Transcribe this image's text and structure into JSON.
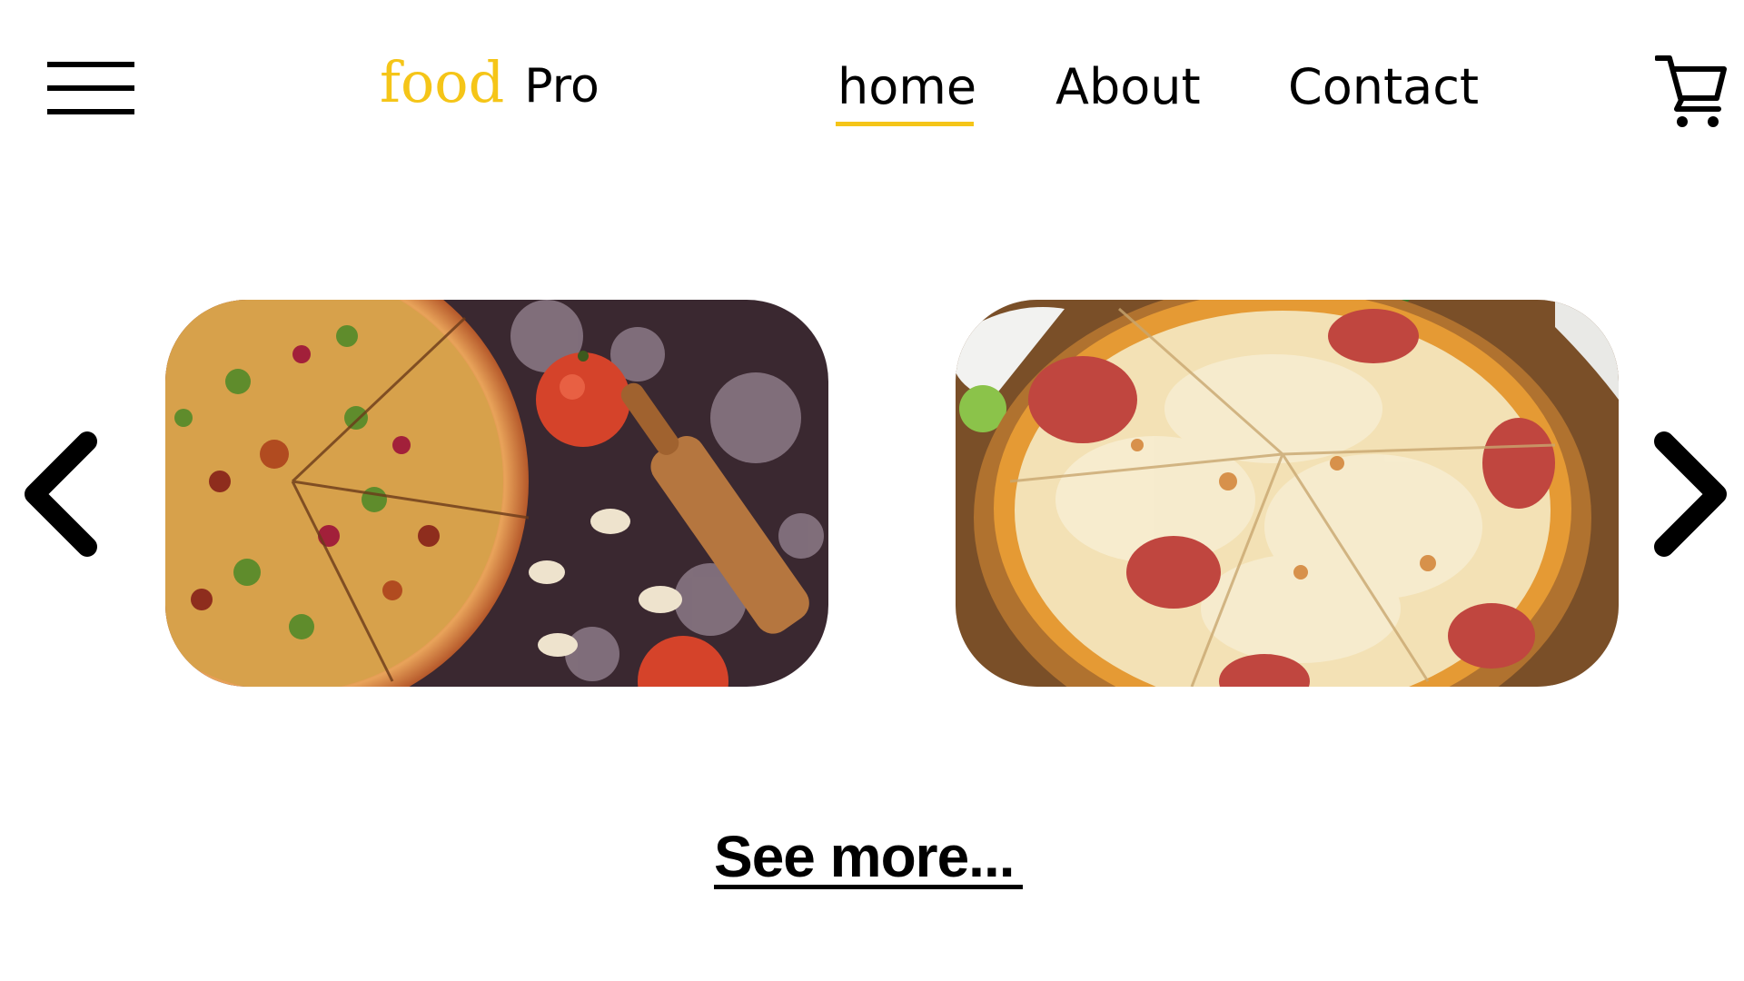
{
  "header": {
    "logo": {
      "primary": "food",
      "secondary": "Pro"
    },
    "nav": [
      {
        "label": "home",
        "active": true
      },
      {
        "label": "About",
        "active": false
      },
      {
        "label": "Contact",
        "active": false
      }
    ],
    "menu_icon": "hamburger-menu-icon",
    "cart_icon": "shopping-cart-icon"
  },
  "carousel": {
    "prev_icon": "chevron-left-icon",
    "next_icon": "chevron-right-icon",
    "cards": [
      {
        "image": "vegetable-pizza-with-tomatoes-and-rolling-pin"
      },
      {
        "image": "pepperoni-cheese-pizza-on-wooden-board"
      }
    ]
  },
  "see_more": {
    "label": "See more..."
  },
  "colors": {
    "accent": "#f5c518",
    "text": "#000000",
    "background": "#ffffff"
  }
}
